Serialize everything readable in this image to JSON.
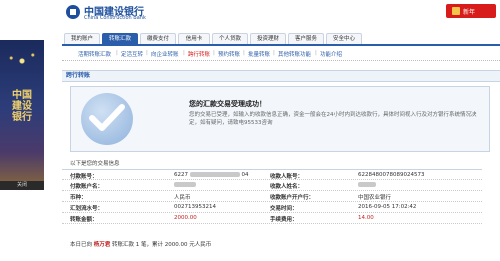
{
  "side_banner": {
    "vertical_text": "中国建设银行",
    "close_label": "关闭"
  },
  "header": {
    "bank_name_cn": "中国建设银行",
    "bank_name_en": "China Construction Bank",
    "tag_label": "新年"
  },
  "nav": {
    "tabs": [
      {
        "label": "我的账户",
        "active": false
      },
      {
        "label": "转账汇款",
        "active": true
      },
      {
        "label": "缴费支付",
        "active": false
      },
      {
        "label": "信用卡",
        "active": false
      },
      {
        "label": "个人贷款",
        "active": false
      },
      {
        "label": "投资理财",
        "active": false
      },
      {
        "label": "客户服务",
        "active": false
      },
      {
        "label": "安全中心",
        "active": false
      }
    ]
  },
  "subnav": {
    "items": [
      {
        "label": "活期转账汇款",
        "active": false
      },
      {
        "label": "定活互转",
        "active": false
      },
      {
        "label": "向企业转账",
        "active": false
      },
      {
        "label": "跨行转账",
        "active": true
      },
      {
        "label": "预约转账",
        "active": false
      },
      {
        "label": "批量转账",
        "active": false
      },
      {
        "label": "其他转账功能",
        "active": false
      },
      {
        "label": "功能介绍",
        "active": false
      }
    ]
  },
  "section_title": "跨行转账",
  "success": {
    "title": "您的汇款交易受理成功！",
    "message": "您的交易已受理，如输入的收款信息正确，资金一般会在24小时内到达收款行，具体时间视入行及对方银行系统情况决定，如有疑问，请致电95533咨询"
  },
  "info_label": "以下是您的交易信息",
  "fields": {
    "payer_account_label": "付款账号：",
    "payer_account_value": "6227",
    "payer_account_tail": "04",
    "payee_account_label": "收款人账号：",
    "payee_account_value": "6228480078089024573",
    "payer_name_label": "付款账户名：",
    "payee_name_label": "收款人姓名：",
    "currency_label": "币种：",
    "currency_value": "人民币",
    "payee_bank_label": "收款账户开户行：",
    "payee_bank_value": "中国农业银行",
    "serial_label": "汇划流水号：",
    "serial_value": "002713953214",
    "time_label": "交易时间：",
    "time_value": "2016-09-05 17:02:42",
    "amount_label": "转账金额：",
    "amount_value": "2000.00",
    "fee_label": "手续费用：",
    "fee_value": "14.00"
  },
  "summary": {
    "prefix": "本日已向",
    "name": "杨万君",
    "middle": "转账汇款 1 笔，累计",
    "total": "2000.00",
    "suffix": "元人民币"
  },
  "colors": {
    "brand_blue": "#2a5daa",
    "accent_red": "#d81b1b",
    "amount_red": "#c0211f"
  }
}
